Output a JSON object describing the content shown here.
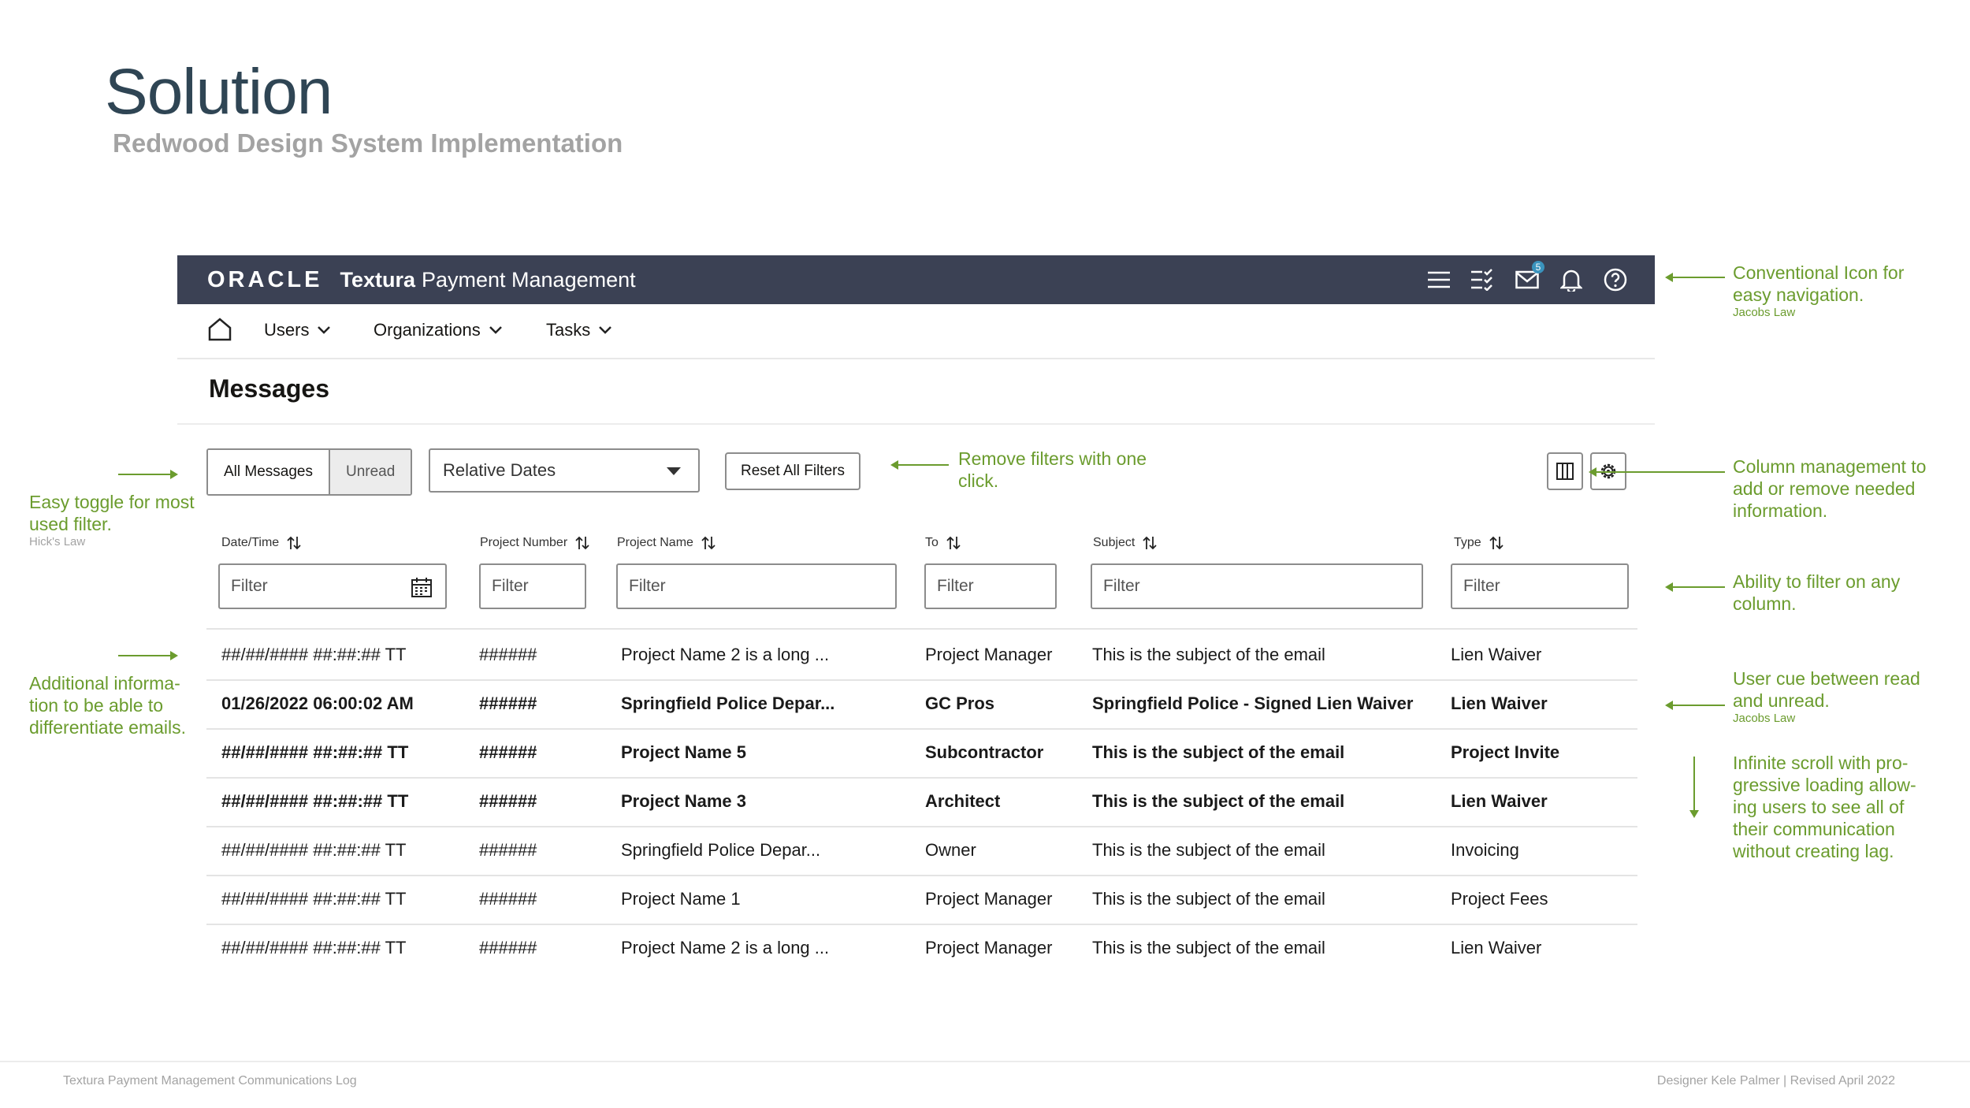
{
  "slide": {
    "title": "Solution",
    "subtitle": "Redwood Design System Implementation"
  },
  "app_header": {
    "logo": "ORACLE",
    "product_bold": "Textura",
    "product": "Payment Management",
    "mail_badge": "5"
  },
  "nav": {
    "items": [
      {
        "label": "Users"
      },
      {
        "label": "Organizations"
      },
      {
        "label": "Tasks"
      }
    ]
  },
  "page": {
    "title": "Messages"
  },
  "toolbar": {
    "toggle_all": "All Messages",
    "toggle_unread": "Unread",
    "date_select_value": "Relative Dates",
    "reset_label": "Reset All Filters"
  },
  "table": {
    "columns": [
      {
        "label": "Date/Time",
        "filter_placeholder": "Filter"
      },
      {
        "label": "Project Number",
        "filter_placeholder": "Filter"
      },
      {
        "label": "Project Name",
        "filter_placeholder": "Filter"
      },
      {
        "label": "To",
        "filter_placeholder": "Filter"
      },
      {
        "label": "Subject",
        "filter_placeholder": "Filter"
      },
      {
        "label": "Type",
        "filter_placeholder": "Filter"
      }
    ],
    "rows": [
      {
        "date": "##/##/#### ##:##:## TT",
        "number": "######",
        "name": "Project Name 2 is a long ...",
        "to": "Project Manager",
        "subject": "This is the subject of the email",
        "type": "Lien Waiver",
        "unread": false
      },
      {
        "date": "01/26/2022   06:00:02 AM",
        "number": "######",
        "name": "Springfield Police Depar...",
        "to": "GC Pros",
        "subject": "Springfield Police - Signed Lien Waiver",
        "type": "Lien Waiver",
        "unread": true
      },
      {
        "date": "##/##/#### ##:##:## TT",
        "number": "######",
        "name": "Project Name 5",
        "to": "Subcontractor",
        "subject": "This is the subject of the email",
        "type": "Project Invite",
        "unread": true
      },
      {
        "date": "##/##/#### ##:##:## TT",
        "number": "######",
        "name": "Project Name 3",
        "to": "Architect",
        "subject": "This is the subject of the email",
        "type": "Lien Waiver",
        "unread": true
      },
      {
        "date": "##/##/#### ##:##:## TT",
        "number": "######",
        "name": "Springfield Police Depar...",
        "to": "Owner",
        "subject": "This is the subject of the email",
        "type": "Invoicing",
        "unread": false
      },
      {
        "date": "##/##/#### ##:##:## TT",
        "number": "######",
        "name": "Project Name 1",
        "to": "Project Manager",
        "subject": "This is the subject of the email",
        "type": "Project Fees",
        "unread": false
      },
      {
        "date": "##/##/#### ##:##:## TT",
        "number": "######",
        "name": "Project Name 2 is a long ...",
        "to": "Project Manager",
        "subject": "This is the subject of the email",
        "type": "Lien Waiver",
        "unread": false
      }
    ]
  },
  "annotations": {
    "nav_icons": {
      "lines": [
        "Conventional Icon for",
        "easy navigation."
      ],
      "law": "Jacobs Law"
    },
    "remove_filters": {
      "lines": [
        "Remove filters with one",
        "click."
      ]
    },
    "column_mgmt": {
      "lines": [
        "Column management to",
        "add or remove needed",
        "information."
      ]
    },
    "toggle": {
      "lines": [
        "Easy toggle for most",
        "used filter."
      ],
      "law": "Hick's Law"
    },
    "filter_any": {
      "lines": [
        "Ability to filter on any",
        "column."
      ]
    },
    "additional_info": {
      "lines": [
        "Additional informa-",
        "tion to be able to",
        "differentiate emails."
      ]
    },
    "read_cue": {
      "lines": [
        "User cue between read",
        "and unread."
      ],
      "law": "Jacobs Law"
    },
    "infinite_scroll": {
      "lines": [
        "Infinite scroll with pro-",
        "gressive loading allow-",
        "ing users to see all of",
        "their communication",
        "without creating lag."
      ]
    }
  },
  "footer": {
    "left": "Textura Payment Management Communications Log",
    "right": "Designer Kele Palmer | Revised April 2022"
  },
  "colors": {
    "header_bg": "#3b4154",
    "annotation": "#6b9c2e",
    "title": "#2f4554",
    "badge": "#3a93bd"
  }
}
